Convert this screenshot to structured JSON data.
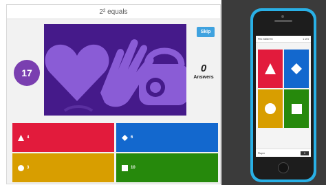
{
  "question": {
    "title": "2² equals"
  },
  "timer": {
    "seconds": "17"
  },
  "skip": {
    "label": "Skip"
  },
  "answers_panel": {
    "count": "0",
    "label": "Answers"
  },
  "answers": [
    {
      "shape": "triangle-icon",
      "text": "4",
      "color": "#e21b3c"
    },
    {
      "shape": "diamond-icon",
      "text": "6",
      "color": "#1368ce"
    },
    {
      "shape": "circle-icon",
      "text": "3",
      "color": "#d89e00"
    },
    {
      "shape": "square-icon",
      "text": "10",
      "color": "#26890c"
    }
  ],
  "phone": {
    "top_left": "PIN: 5838778",
    "top_right": "1 of 5",
    "bottom_left": "Player",
    "bottom_right": "0",
    "body_color": "#29b0e6"
  },
  "media": {
    "description_icons": [
      "heart-icon",
      "hand-icon",
      "bag-icon"
    ],
    "bg_color": "#451a8a",
    "shape_color": "#8a5cd6"
  }
}
